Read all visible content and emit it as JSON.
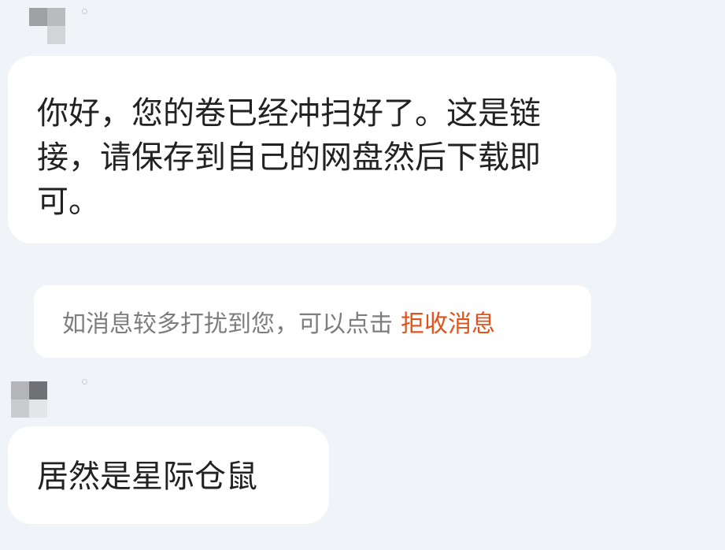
{
  "conversation": {
    "messages": [
      {
        "text": "你好，您的卷已经冲扫好了。这是链接，请保存到自己的网盘然后下载即可。"
      },
      {
        "text": "居然是星际仓鼠"
      }
    ],
    "notice": {
      "text": "如消息较多打扰到您，可以点击",
      "link_label": "拒收消息",
      "link_color": "#e0531b"
    }
  }
}
